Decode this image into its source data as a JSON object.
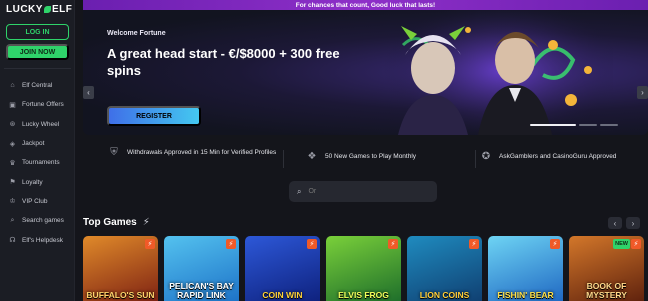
{
  "brand": {
    "logo_text_left": "LUCKY",
    "logo_text_right": "ELF"
  },
  "auth": {
    "login_label": "LOG IN",
    "join_label": "JOIN NOW"
  },
  "nav": {
    "items": [
      {
        "label": "Elf Central",
        "icon": "home-icon"
      },
      {
        "label": "Fortune Offers",
        "icon": "gift-icon"
      },
      {
        "label": "Lucky Wheel",
        "icon": "wheel-icon"
      },
      {
        "label": "Jackpot",
        "icon": "jackpot-icon"
      },
      {
        "label": "Tournaments",
        "icon": "trophy-icon"
      },
      {
        "label": "Loyalty",
        "icon": "flag-icon"
      },
      {
        "label": "VIP Club",
        "icon": "crown-icon"
      },
      {
        "label": "Search games",
        "icon": "search-icon"
      },
      {
        "label": "Elf's Helpdesk",
        "icon": "headset-icon"
      }
    ]
  },
  "top_banner": {
    "text": "For chances that count, Good luck that lasts!"
  },
  "hero": {
    "welcome": "Welcome Fortune",
    "title": "A great head start - €/$8000 + 300 free spins",
    "register_label": "REGISTER",
    "active_slide": 1,
    "slide_count": 3
  },
  "features": [
    {
      "icon": "shield-check-icon",
      "text": "Withdrawals Approved in 15 Min for Verified Profiles"
    },
    {
      "icon": "games-icon",
      "text": "50 New Games to Play Monthly"
    },
    {
      "icon": "ribbon-icon",
      "text": "AskGamblers and CasinoGuru Approved"
    }
  ],
  "search": {
    "placeholder": "Or"
  },
  "top_games": {
    "title": "Top Games",
    "games": [
      {
        "name": "BUFFALO'S SUN",
        "bg1": "#7a1e12",
        "bg2": "#e08a2a",
        "color": "#ffd36a",
        "new": false
      },
      {
        "name": "PELICAN'S BAY RAPID LINK",
        "bg1": "#1b6fc6",
        "bg2": "#54c2ef",
        "color": "#ffffff",
        "new": false
      },
      {
        "name": "COIN WIN",
        "bg1": "#0d1f7a",
        "bg2": "#2d58d8",
        "color": "#ffd23a",
        "new": false
      },
      {
        "name": "ELVIS FROG",
        "bg1": "#1a6a2a",
        "bg2": "#7ad03a",
        "color": "#f2ff5a",
        "new": false
      },
      {
        "name": "LION COINS",
        "bg1": "#0f3c6e",
        "bg2": "#1f8bbf",
        "color": "#ffcf3a",
        "new": false
      },
      {
        "name": "FISHIN' BEAR",
        "bg1": "#1c63c0",
        "bg2": "#6ed4f4",
        "color": "#ffe14a",
        "new": false
      },
      {
        "name": "BOOK OF MYSTERY",
        "bg1": "#5a1e0c",
        "bg2": "#d3772a",
        "color": "#ffd88a",
        "new": true
      }
    ]
  },
  "colors": {
    "accent_green": "#2fd36a",
    "banner_purple": "#8e2fc8",
    "register_blue": "#3f6fe8",
    "hot_badge": "#f05a28"
  }
}
